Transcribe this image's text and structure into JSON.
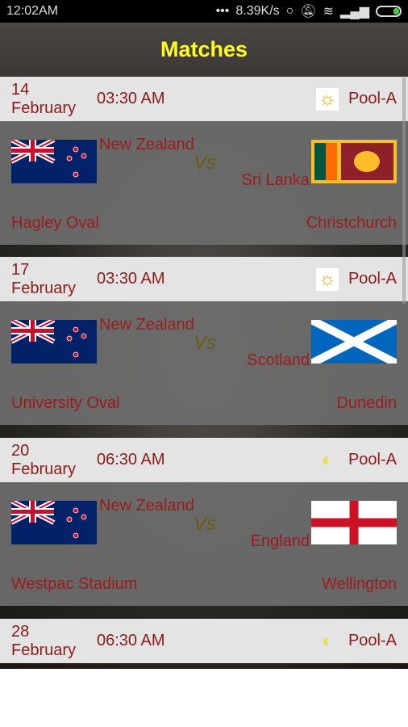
{
  "status": {
    "time": "12:02AM",
    "dots": "•••",
    "speed": "8.39K/s"
  },
  "title": "Matches",
  "matches": [
    {
      "date": "14 February",
      "time": "03:30 AM",
      "weather": "sunny",
      "pool": "Pool-A",
      "team1": "New Zealand",
      "team2": "Sri Lanka",
      "vs": "Vs",
      "ground": "Hagley Oval",
      "city": "Christchurch"
    },
    {
      "date": "17 February",
      "time": "03:30 AM",
      "weather": "sunny",
      "pool": "Pool-A",
      "team1": "New Zealand",
      "team2": "Scotland",
      "vs": "Vs",
      "ground": "University Oval",
      "city": "Dunedin"
    },
    {
      "date": "20 February",
      "time": "06:30 AM",
      "weather": "partly-cloudy",
      "pool": "Pool-A",
      "team1": "New Zealand",
      "team2": "England",
      "vs": "Vs",
      "ground": "Westpac Stadium",
      "city": "Wellington"
    },
    {
      "date": "28 February",
      "time": "06:30 AM",
      "weather": "partly-cloudy",
      "pool": "Pool-A"
    }
  ]
}
